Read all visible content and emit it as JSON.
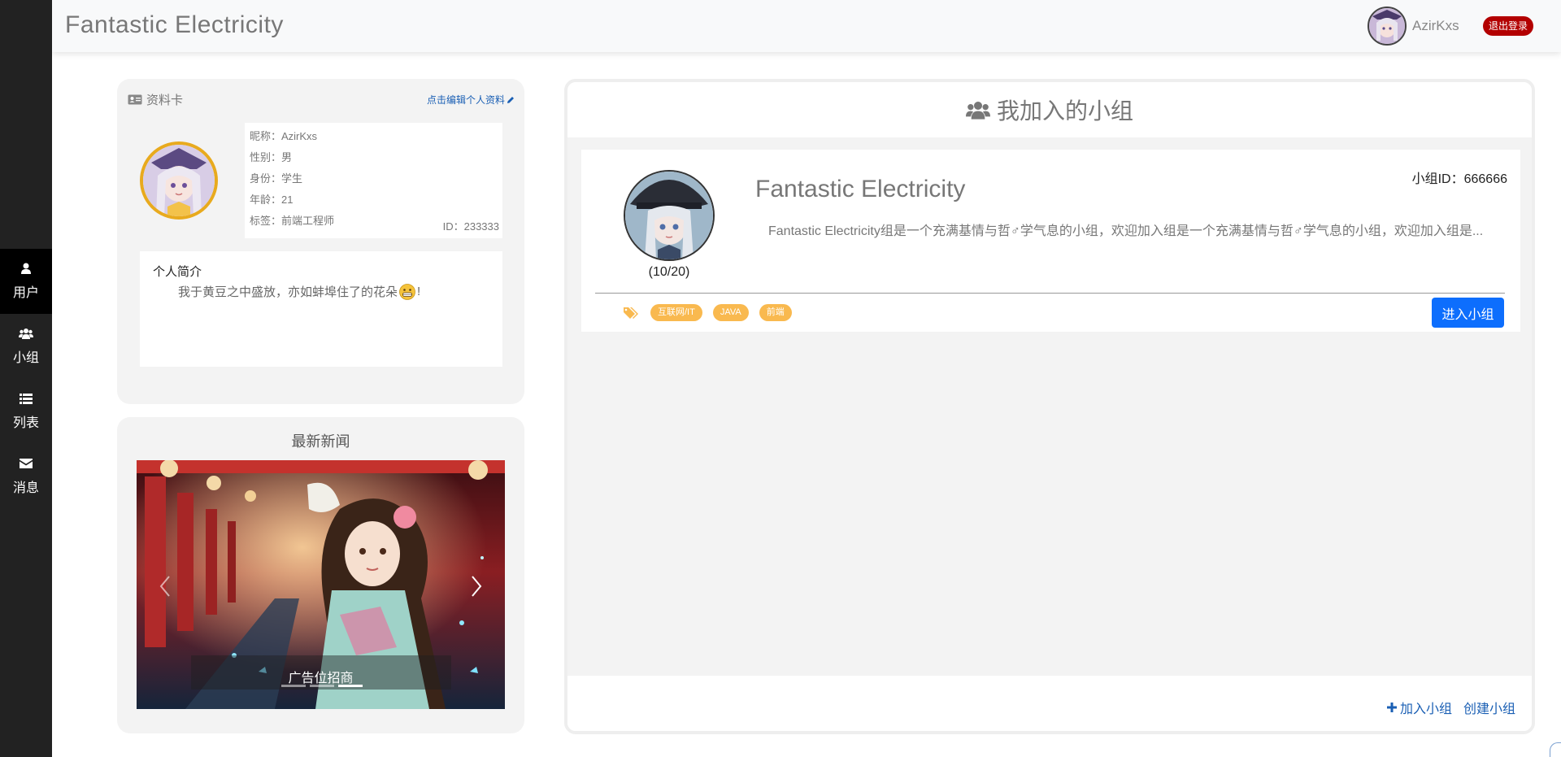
{
  "header": {
    "brand": "Fantastic Electricity",
    "username": "AzirKxs",
    "logout_label": "退出登录"
  },
  "sidebar": {
    "items": [
      {
        "label": "用户",
        "icon": "user-icon",
        "active": true
      },
      {
        "label": "小组",
        "icon": "users-icon",
        "active": false
      },
      {
        "label": "列表",
        "icon": "list-icon",
        "active": false
      },
      {
        "label": "消息",
        "icon": "envelope-icon",
        "active": false
      }
    ]
  },
  "profile": {
    "title": "资料卡",
    "edit_label": "点击编辑个人资料",
    "nickname": "昵称：AzirKxs",
    "gender": "性别：男",
    "identity": "身份：学生",
    "age": "年龄：21",
    "tag": "标签：前端工程师",
    "id": "ID：233333",
    "intro_title": "个人简介",
    "intro_text_before": "我于黄豆之中盛放，亦如蚌埠住了的花朵",
    "intro_text_after": "!"
  },
  "news": {
    "title": "最新新闻",
    "caption": "广告位招商",
    "slides": 3,
    "active_slide": 3
  },
  "groups": {
    "title": "我加入的小组",
    "items": [
      {
        "name": "Fantastic Electricity",
        "id_label": "小组ID：666666",
        "count": "(10/20)",
        "description": "Fantastic Electricity组是一个充满基情与哲♂学气息的小组，欢迎加入组是一个充满基情与哲♂学气息的小组，欢迎加入组是...",
        "tags": [
          "互联网/IT",
          "JAVA",
          "前端"
        ],
        "enter_label": "进入小组"
      }
    ],
    "join_label": "加入小组",
    "create_label": "创建小组"
  },
  "colors": {
    "sidebar_bg": "#222222",
    "logout_red": "#b30000",
    "primary_blue": "#0d6efd",
    "tag_orange": "#f9b94f",
    "avatar_border": "#e8aa1e",
    "link_blue": "#1a5fb4"
  }
}
